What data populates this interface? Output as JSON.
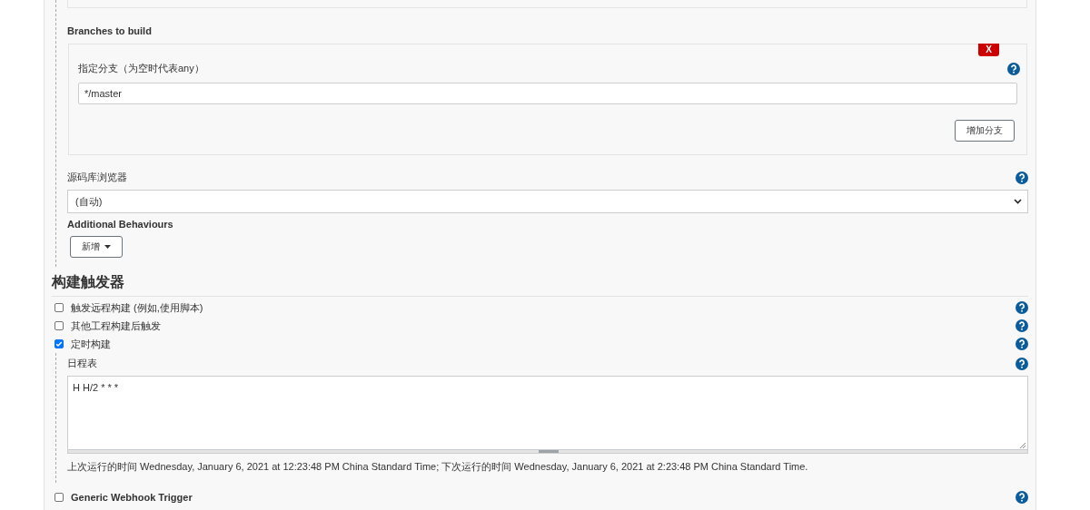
{
  "branches_to_build": {
    "title": "Branches to build",
    "branch": {
      "label": "指定分支（为空时代表any）",
      "value": "*/master",
      "delete_label": "X",
      "add_button": "增加分支"
    }
  },
  "repository_browser": {
    "label": "源码库浏览器",
    "value": "(自动)"
  },
  "additional_behaviours": {
    "title": "Additional Behaviours",
    "add_button": "新增"
  },
  "build_triggers": {
    "heading": "构建触发器",
    "options": [
      {
        "kind": "plain",
        "label": "触发远程构建 (例如,使用脚本)",
        "checked": false
      },
      {
        "kind": "plain",
        "label": "其他工程构建后触发",
        "checked": false
      },
      {
        "kind": "plain",
        "label": "定时构建",
        "checked": true,
        "schedule": {
          "label": "日程表",
          "value": "H H/2 * * *",
          "note": "上次运行的时间 Wednesday, January 6, 2021 at 12:23:48 PM China Standard Time; 下次运行的时间 Wednesday, January 6, 2021 at 2:23:48 PM China Standard Time."
        }
      },
      {
        "kind": "plugin",
        "label": "Generic Webhook Trigger",
        "checked": false
      }
    ]
  }
}
